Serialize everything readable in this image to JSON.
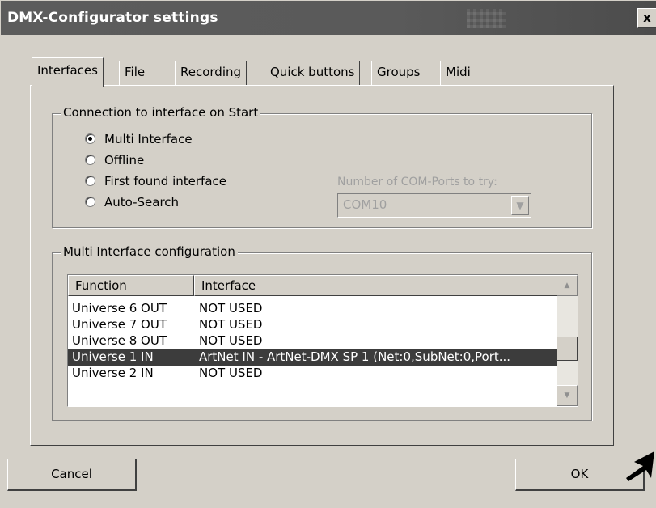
{
  "window": {
    "title": "DMX-Configurator settings",
    "close_glyph": "x"
  },
  "tabs": [
    {
      "label": "Interfaces",
      "active": true
    },
    {
      "label": "File",
      "active": false
    },
    {
      "label": "Recording",
      "active": false
    },
    {
      "label": "Quick buttons",
      "active": false
    },
    {
      "label": "Groups",
      "active": false
    },
    {
      "label": "Midi",
      "active": false
    }
  ],
  "connection": {
    "legend": "Connection to interface on Start",
    "options": [
      {
        "label": "Multi Interface",
        "checked": true
      },
      {
        "label": "Offline",
        "checked": false
      },
      {
        "label": "First found interface",
        "checked": false
      },
      {
        "label": "Auto-Search",
        "checked": false
      }
    ],
    "com_ports_label": "Number of COM-Ports to try:",
    "com_ports_value": "COM10",
    "com_ports_enabled": false
  },
  "multi": {
    "legend": "Multi Interface configuration",
    "columns": [
      "Function",
      "Interface"
    ],
    "rows": [
      {
        "function": "Universe 6 OUT",
        "interface": "NOT USED",
        "selected": false
      },
      {
        "function": "Universe 7 OUT",
        "interface": "NOT USED",
        "selected": false
      },
      {
        "function": "Universe 8 OUT",
        "interface": "NOT USED",
        "selected": false
      },
      {
        "function": "Universe 1 IN",
        "interface": "ArtNet IN - ArtNet-DMX SP 1 (Net:0,SubNet:0,Port...",
        "selected": true
      },
      {
        "function": "Universe 2 IN",
        "interface": "NOT USED",
        "selected": false
      }
    ]
  },
  "buttons": {
    "cancel": "Cancel",
    "ok": "OK"
  },
  "icons": {
    "scroll_up": "scroll-up-arrow-icon",
    "scroll_down": "scroll-down-arrow-icon",
    "combo_dropdown": "chevron-down-icon",
    "cursor_arrow": "pointer-arrow-icon"
  }
}
